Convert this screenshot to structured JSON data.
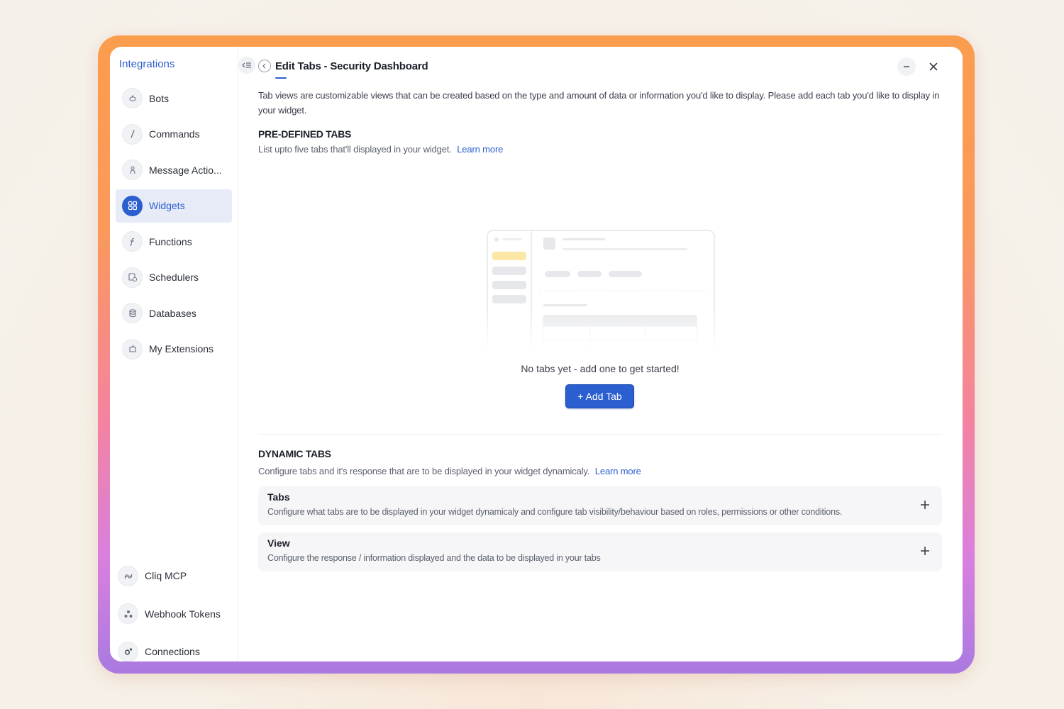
{
  "sidebar": {
    "title": "Integrations",
    "items": [
      {
        "label": "Bots",
        "icon": "bot-icon"
      },
      {
        "label": "Commands",
        "icon": "slash-icon"
      },
      {
        "label": "Message Actio...",
        "icon": "hand-icon"
      },
      {
        "label": "Widgets",
        "icon": "grid-icon",
        "active": true
      },
      {
        "label": "Functions",
        "icon": "function-icon"
      },
      {
        "label": "Schedulers",
        "icon": "scheduler-icon"
      },
      {
        "label": "Databases",
        "icon": "database-icon"
      },
      {
        "label": "My Extensions",
        "icon": "puzzle-icon"
      }
    ],
    "bottom_items": [
      {
        "label": "Cliq MCP",
        "icon": "mcp-icon"
      },
      {
        "label": "Webhook Tokens",
        "icon": "webhook-icon"
      },
      {
        "label": "Connections",
        "icon": "connections-icon"
      }
    ]
  },
  "header": {
    "title": "Edit Tabs - Security Dashboard"
  },
  "intro": "Tab views are customizable views that can be created based on the type and amount of data or information you'd like to display. Please add each tab you'd like to display in your widget.",
  "predefined": {
    "title": "PRE-DEFINED TABS",
    "desc": "List upto five tabs that'll displayed in your widget.",
    "link": "Learn more",
    "empty_text": "No tabs yet - add one to get started!",
    "add_button": "+ Add Tab"
  },
  "dynamic": {
    "title": "DYNAMIC TABS",
    "desc": "Configure tabs and it's response that are to be displayed in your widget dynamicaly.",
    "link": "Learn more",
    "cards": [
      {
        "title": "Tabs",
        "desc": "Configure what tabs are to be displayed in your widget dynamicaly and configure tab visibility/behaviour based on roles, permissions or other conditions."
      },
      {
        "title": "View",
        "desc": "Configure the response / information displayed and the data to be displayed in your tabs"
      }
    ]
  },
  "colors": {
    "accent": "#2b5fd0",
    "frame_top": "#fb9d4e",
    "frame_bottom": "#a97ae0"
  }
}
